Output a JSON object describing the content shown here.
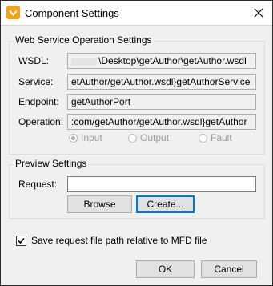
{
  "window": {
    "title": "Component Settings"
  },
  "ws_group": {
    "title": "Web Service Operation Settings",
    "wsdl": {
      "label": "WSDL:",
      "value": "\\Desktop\\getAuthor\\getAuthor.wsdl"
    },
    "service": {
      "label": "Service:",
      "value": "etAuthor/getAuthor.wsdl}getAuthorService"
    },
    "endpoint": {
      "label": "Endpoint:",
      "value": "getAuthorPort"
    },
    "operation": {
      "label": "Operation:",
      "value": ":com/getAuthor/getAuthor.wsdl}getAuthor"
    },
    "modes": [
      {
        "label": "Input",
        "selected": true
      },
      {
        "label": "Output",
        "selected": false
      },
      {
        "label": "Fault",
        "selected": false
      }
    ]
  },
  "preview_group": {
    "title": "Preview Settings",
    "request_label": "Request:",
    "request_value": "",
    "browse_label": "Browse",
    "create_label": "Create..."
  },
  "save_relative": {
    "label": "Save request file path relative to MFD file",
    "checked": true
  },
  "footer": {
    "ok_label": "OK",
    "cancel_label": "Cancel"
  }
}
